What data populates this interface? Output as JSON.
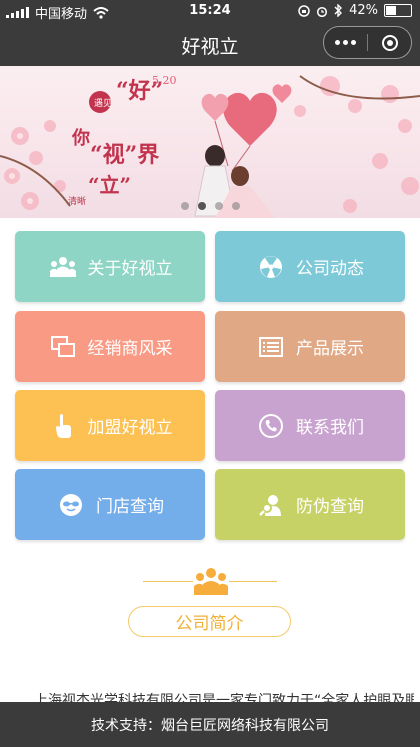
{
  "status_bar": {
    "carrier": "中国移动",
    "time": "15:24",
    "battery": "42%"
  },
  "nav": {
    "title": "好视立"
  },
  "banner": {
    "headline_1": "遇见",
    "headline_2": "“好”",
    "headline_3": "你",
    "headline_4": "“视”界",
    "headline_5": "“立”",
    "headline_6": "清晰",
    "date": "5.20",
    "slide_count": 4,
    "active_slide": 1
  },
  "menu": {
    "about": "关于好视立",
    "news": "公司动态",
    "dealers": "经销商风采",
    "products": "产品展示",
    "join": "加盟好视立",
    "contact": "联系我们",
    "stores": "门店查询",
    "anticounterfeit": "防伪查询"
  },
  "colors": {
    "about": "#8fd5c6",
    "news": "#7ec9d8",
    "dealers": "#f99b84",
    "products": "#e1a886",
    "join": "#fcc152",
    "contact": "#c9a3cf",
    "stores": "#74aeea",
    "anticounterfeit": "#c7d266"
  },
  "intro": {
    "title": "公司简介",
    "text": "上海视杰光学科技有限公司是一家专门致力于“全家人护眼及眼"
  },
  "footer": {
    "text": "技术支持：烟台巨匠网络科技有限公司"
  }
}
